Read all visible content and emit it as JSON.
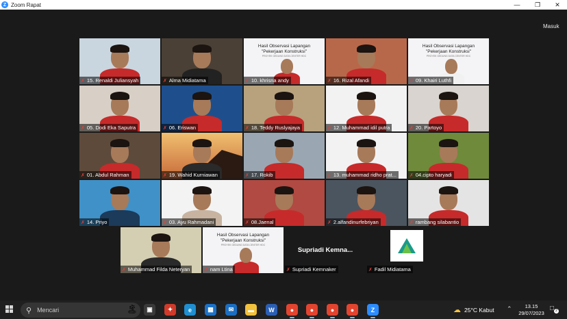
{
  "window": {
    "title": "Zoom Rapat",
    "minimize_icon": "minimize-icon",
    "maximize_icon": "restore-icon",
    "close_icon": "close-icon"
  },
  "toolbar": {
    "enter_label": "Masuk"
  },
  "participants": [
    {
      "name": "15. Renaldi Juliansyah",
      "bg": "#c9d6df",
      "shirt": "#c72a2a",
      "kind": "person"
    },
    {
      "name": "Alma Midiatama",
      "bg": "#4b4036",
      "shirt": "#222222",
      "kind": "person",
      "active": true
    },
    {
      "name": "10. khrisna andy",
      "bg": "#eeeeee",
      "shirt": "#c72a2a",
      "kind": "slide"
    },
    {
      "name": "16. Rizal Afandi",
      "bg": "#b8684a",
      "shirt": "#c72a2a",
      "kind": "person"
    },
    {
      "name": "09. Khairi Luthfi",
      "bg": "#f1f1f1",
      "shirt": "#f1f1f1",
      "kind": "slide"
    },
    {
      "name": "05. Dodi Eka Saputra",
      "bg": "#d8d0c7",
      "shirt": "#c72a2a",
      "kind": "person"
    },
    {
      "name": "06. Eriswan",
      "bg": "#1e4f8c",
      "shirt": "#c72a2a",
      "kind": "person"
    },
    {
      "name": "18. Teddy Ruslyajaya",
      "bg": "#b7a27d",
      "shirt": "#c72a2a",
      "kind": "person"
    },
    {
      "name": "12. Muhammad idil putra",
      "bg": "#f2f2f2",
      "shirt": "#c72a2a",
      "kind": "person"
    },
    {
      "name": "20. Partoyo",
      "bg": "#d9d4cf",
      "shirt": "#c72a2a",
      "kind": "person"
    },
    {
      "name": "01. Abdul Rahman",
      "bg": "#5e4a3b",
      "shirt": "#c72a2a",
      "kind": "person"
    },
    {
      "name": "19. Wahid Kurniawan",
      "bg": "#e0a55d",
      "shirt": "#2a2a2a",
      "kind": "sunset"
    },
    {
      "name": "17. Rokib",
      "bg": "#9aa7b2",
      "shirt": "#c72a2a",
      "kind": "person"
    },
    {
      "name": "13. muhammad ridho prat...",
      "bg": "#f2f2f2",
      "shirt": "#c72a2a",
      "kind": "person"
    },
    {
      "name": "04.cipto haryadi",
      "bg": "#6f8a3b",
      "shirt": "#c72a2a",
      "kind": "person"
    },
    {
      "name": "14. Priyo",
      "bg": "#3f91c8",
      "shirt": "#1c3a5a",
      "kind": "person"
    },
    {
      "name": "03. Ayu Rahmadani",
      "bg": "#f3f3f3",
      "shirt": "#c7b3a0",
      "kind": "person"
    },
    {
      "name": "08.Jaenal",
      "bg": "#b04a42",
      "shirt": "#c72a2a",
      "kind": "person"
    },
    {
      "name": "2.alfandinurfebriyan",
      "bg": "#4b5560",
      "shirt": "#c72a2a",
      "kind": "person"
    },
    {
      "name": "rambang silabantio",
      "bg": "#e4e4e4",
      "shirt": "#c72a2a",
      "kind": "person"
    },
    {
      "name": "Muhammad Filda Neteryan",
      "bg": "#d4cfb2",
      "shirt": "#2a2a2a",
      "kind": "person"
    },
    {
      "name": "nam Ltina",
      "bg": "#eeeeee",
      "shirt": "#c72a2a",
      "kind": "slide"
    },
    {
      "name": "Supriadi Kemnaker",
      "bg": "#1a1a1a",
      "shirt": "#1a1a1a",
      "kind": "nameonly",
      "display": "Supriadi   Kemna..."
    },
    {
      "name": "Fadil Midiatama",
      "bg": "#1a1a1a",
      "shirt": "#1a1a1a",
      "kind": "logo"
    }
  ],
  "slide": {
    "line1": "Hasil Observasi Lapangan",
    "line2": "\"Pekerjaan Konstruksi\"",
    "line3": "PROYEK GEDUNG DATA CENTER HDC"
  },
  "taskbar": {
    "search_placeholder": "Mencari",
    "weather": "25°C  Kabut",
    "time": "13.15",
    "date": "29/07/2023",
    "notification_count": "2",
    "apps": [
      "task-view-icon",
      "app-gift-icon",
      "edge-browser-icon",
      "store-icon",
      "mail-icon",
      "file-explorer-icon",
      "word-icon",
      "chrome-icon",
      "chrome-icon",
      "chrome-icon",
      "chrome-icon",
      "zoom-icon"
    ]
  },
  "colors": {
    "accent": "#2d8cff",
    "active_speaker": "#b9d635",
    "uniform_red": "#c72a2a"
  }
}
